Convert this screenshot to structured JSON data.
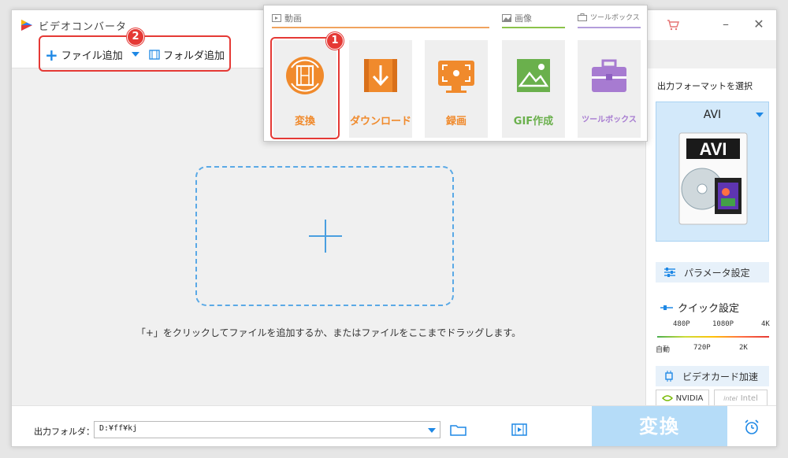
{
  "app": {
    "title": "ビデオコンバータ"
  },
  "window_controls": {
    "cart": "cart-icon",
    "minimize": "–",
    "close": "✕"
  },
  "toolbar": {
    "add_file_label": "ファイル追加",
    "add_folder_label": "フォルダ追加"
  },
  "badges": {
    "one": "1",
    "two": "2"
  },
  "menu": {
    "categories": [
      {
        "label": "動画",
        "color": "#f0a35e"
      },
      {
        "label": "画像",
        "color": "#8bc34a"
      },
      {
        "label": "ツールボックス",
        "color": "#b39ddb"
      }
    ],
    "tiles": [
      {
        "label": "変換",
        "color": "#f08a2c",
        "icon": "film-convert-icon"
      },
      {
        "label": "ダウンロード",
        "color": "#f08a2c",
        "icon": "download-icon"
      },
      {
        "label": "録画",
        "color": "#f08a2c",
        "icon": "screen-record-icon"
      },
      {
        "label": "GIF作成",
        "color": "#6ab04c",
        "icon": "image-icon"
      },
      {
        "label": "ツールボックス",
        "color": "#a77bd1",
        "icon": "toolbox-icon"
      }
    ]
  },
  "drop_zone": {
    "hint": "「+」をクリックしてファイルを追加するか、またはファイルをここまでドラッグします。"
  },
  "right_panel": {
    "title": "出力フォーマットを選択",
    "format": {
      "name": "AVI",
      "badge_text": "AVI"
    },
    "param_label": "パラメータ設定",
    "quick_label": "クイック設定",
    "quality_top": [
      "480P",
      "1080P",
      "4K"
    ],
    "quality_bottom": [
      "自動",
      "720P",
      "2K"
    ],
    "gpu_label": "ビデオカード加速",
    "gpu_vendors": [
      "NVIDIA",
      "Intel"
    ]
  },
  "bottom": {
    "output_label": "出力フォルダ：",
    "output_path": "D:¥ff¥kj",
    "convert_label": "変換"
  }
}
